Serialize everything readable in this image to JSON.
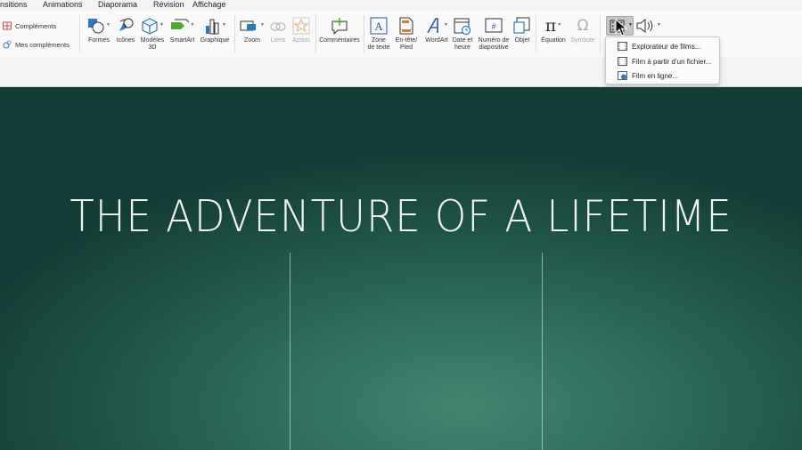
{
  "menu_tabs": [
    "nsitions",
    "Animations",
    "Diaporama",
    "Révision",
    "Affichage"
  ],
  "addins": {
    "complements_label": "Compléments",
    "mes_complements_label": "Mes compléments"
  },
  "ribbon": {
    "formes": "Formes",
    "icones": "Icônes",
    "modeles3d": "Modèles\n3D",
    "smartart": "SmartArt",
    "graphique": "Graphique",
    "zoom": "Zoom",
    "liens": "Liens",
    "action": "Action",
    "commentaires": "Commentaires",
    "zone_texte": "Zone\nde texte",
    "entete_pied": "En-tête/\nPied",
    "wordart": "WordArt",
    "date_heure": "Date et\nheure",
    "numero_diapo": "Numéro de\ndiapositive",
    "objet": "Objet",
    "equation": "Équation",
    "symbole": "Symbole"
  },
  "video_menu": {
    "items": [
      "Explorateur de films...",
      "Film à partir d’un fichier...",
      "Film en ligne..."
    ]
  },
  "slide": {
    "title": "THE ADVENTURE OF A LIFETIME"
  },
  "colors": {
    "accent_blue": "#2b579a",
    "slide_dark": "#153d37",
    "slide_light": "#3f8670"
  }
}
